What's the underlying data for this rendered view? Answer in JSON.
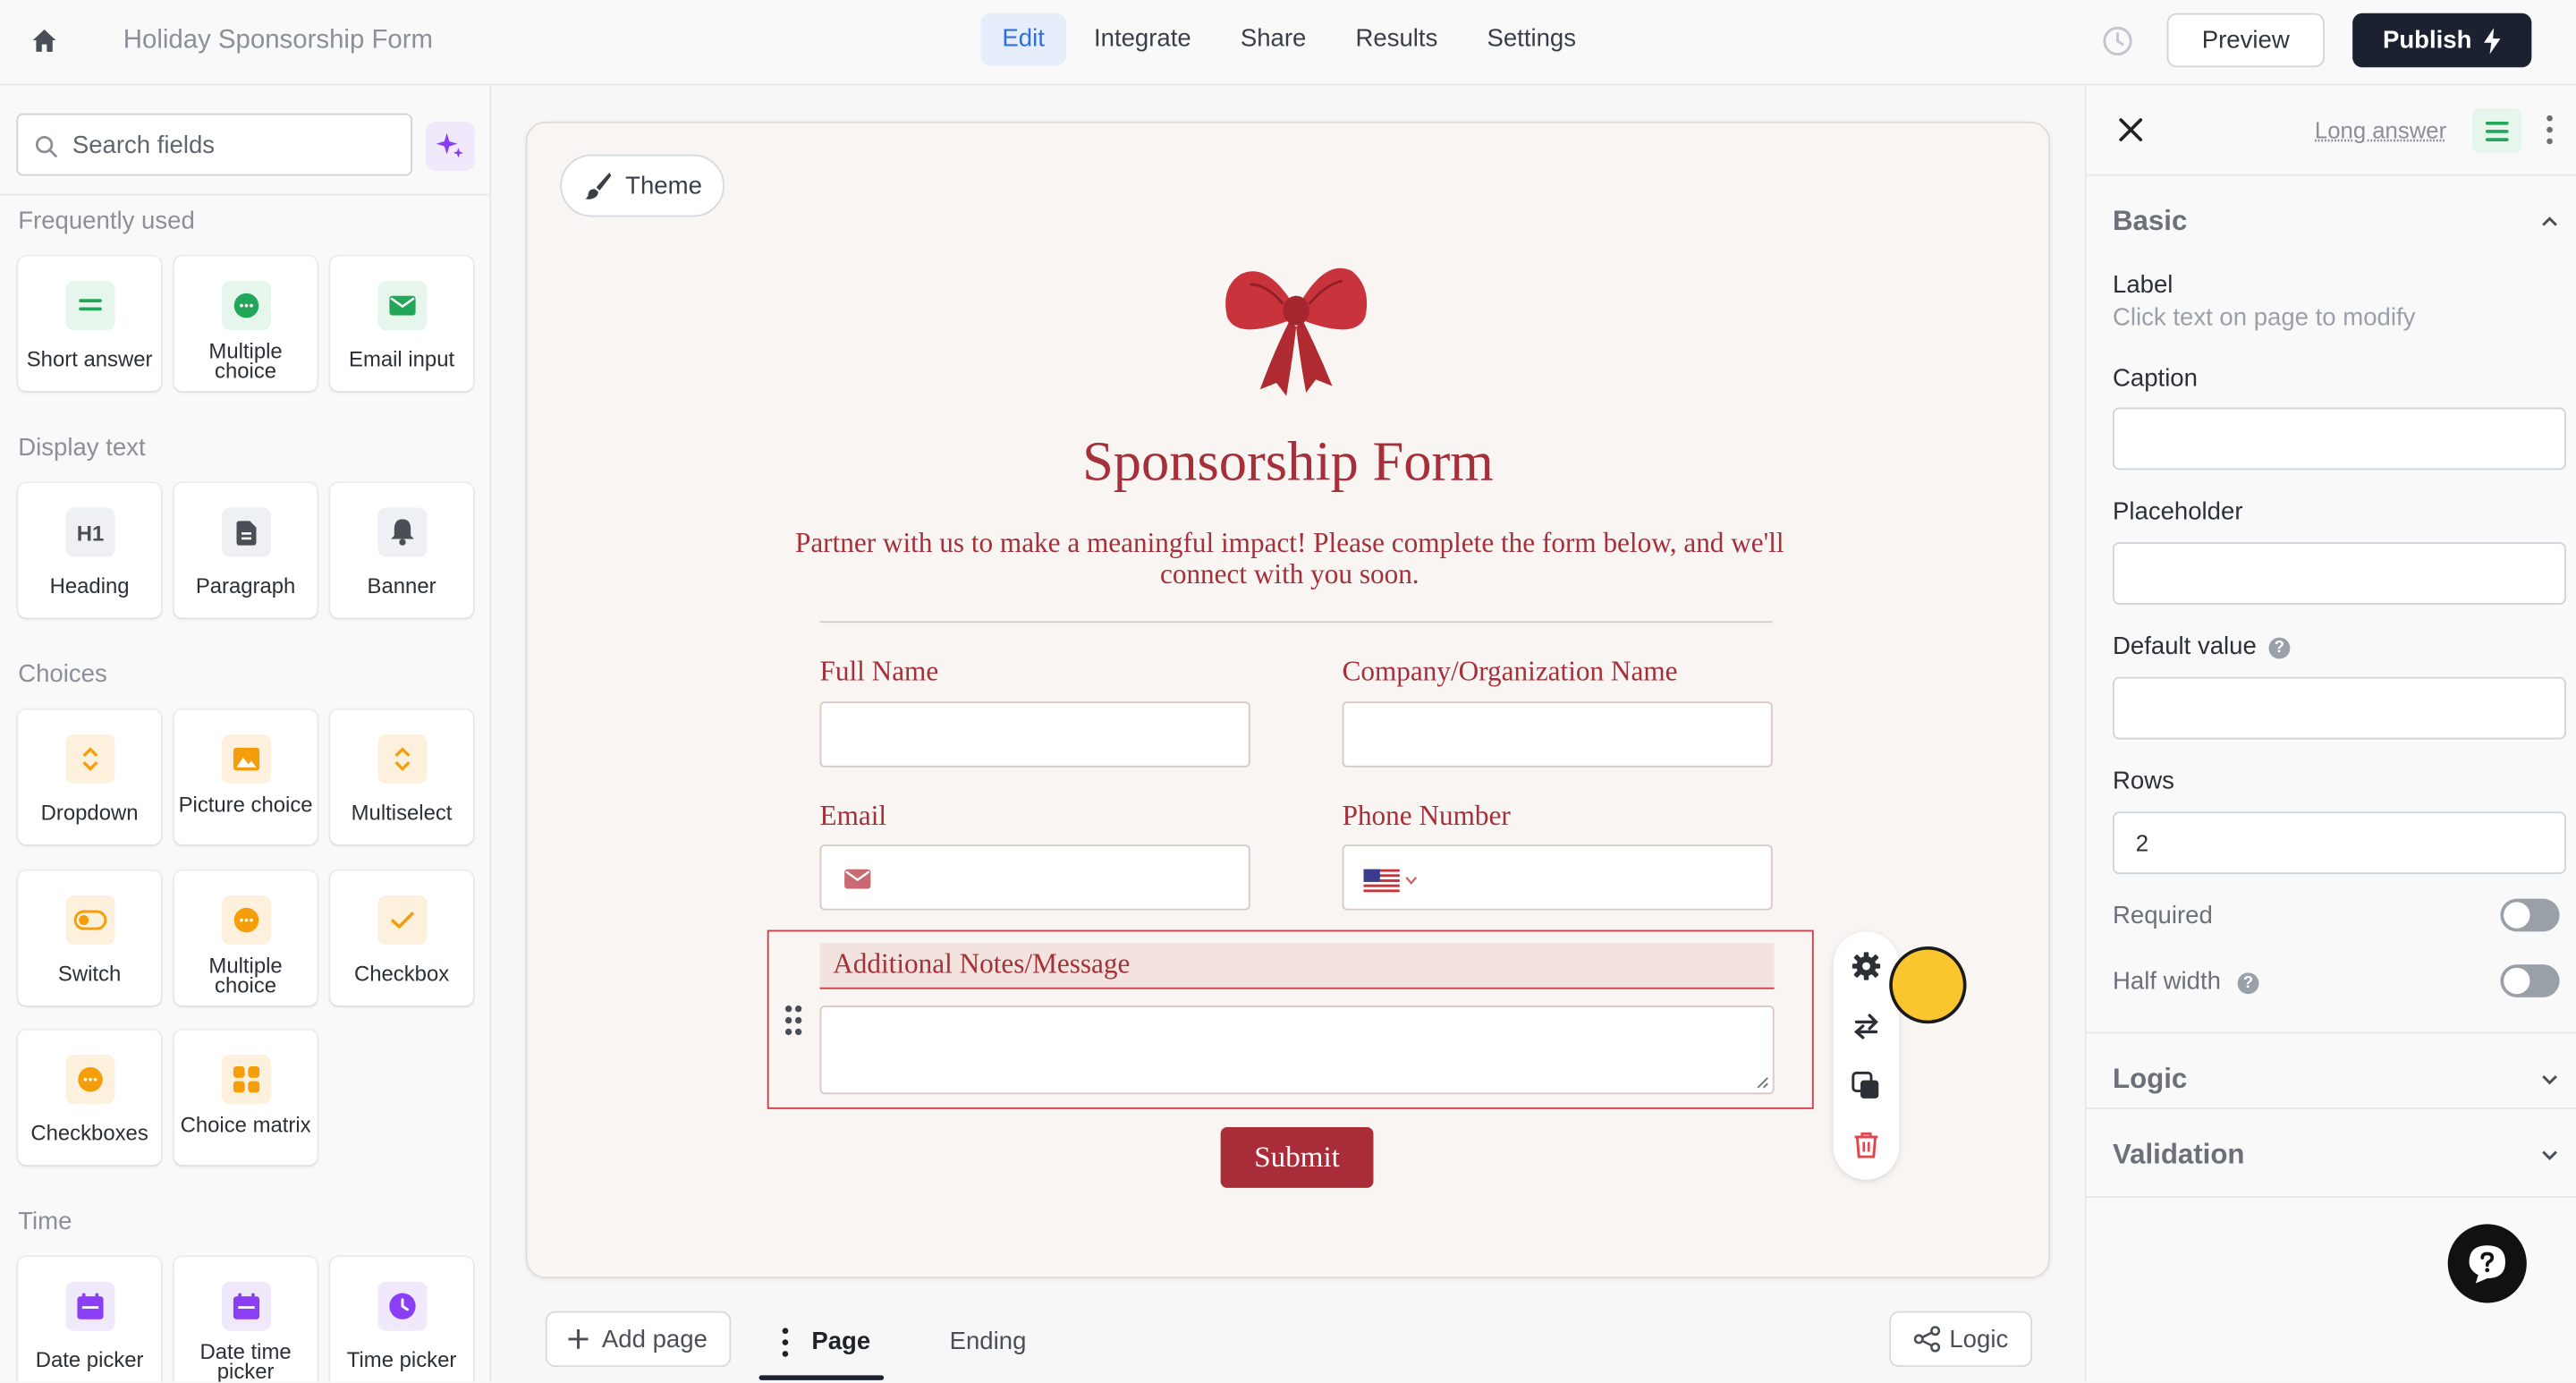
{
  "topbar": {
    "form_title": "Holiday Sponsorship Form",
    "nav": [
      "Edit",
      "Integrate",
      "Share",
      "Results",
      "Settings"
    ],
    "active_nav": "Edit",
    "preview_label": "Preview",
    "publish_label": "Publish"
  },
  "sidebar": {
    "search_placeholder": "Search fields",
    "sections": {
      "frequently_used": "Frequently used",
      "display_text": "Display text",
      "choices": "Choices",
      "time": "Time"
    },
    "frequently_used": [
      "Short answer",
      "Multiple choice",
      "Email input"
    ],
    "display_text": [
      "Heading",
      "Paragraph",
      "Banner"
    ],
    "choices": [
      "Dropdown",
      "Picture choice",
      "Multiselect",
      "Switch",
      "Multiple choice",
      "Checkbox",
      "Checkboxes",
      "Choice matrix"
    ],
    "time": [
      "Date picker",
      "Date time picker",
      "Time picker"
    ]
  },
  "canvas": {
    "theme_label": "Theme",
    "form_heading": "Sponsorship Form",
    "form_description": "Partner with us to make a meaningful impact! Please complete the form below, and we'll connect with you soon.",
    "fields": {
      "full_name": "Full Name",
      "company": "Company/Organization Name",
      "email": "Email",
      "phone": "Phone Number",
      "notes": "Additional Notes/Message"
    },
    "submit_label": "Submit"
  },
  "bottombar": {
    "add_page": "Add page",
    "page_tab": "Page",
    "ending_tab": "Ending",
    "logic": "Logic"
  },
  "rightpanel": {
    "field_type": "Long answer",
    "basic": "Basic",
    "label_title": "Label",
    "label_hint": "Click text on page to modify",
    "caption": "Caption",
    "placeholder": "Placeholder",
    "default_value": "Default value",
    "rows": "Rows",
    "rows_value": "2",
    "required": "Required",
    "half_width": "Half width",
    "logic": "Logic",
    "validation": "Validation"
  },
  "colors": {
    "accent": "#2f6fdb",
    "form_text": "#a5303a",
    "submit_bg": "#a82d39",
    "publish_bg": "#1b2130"
  }
}
